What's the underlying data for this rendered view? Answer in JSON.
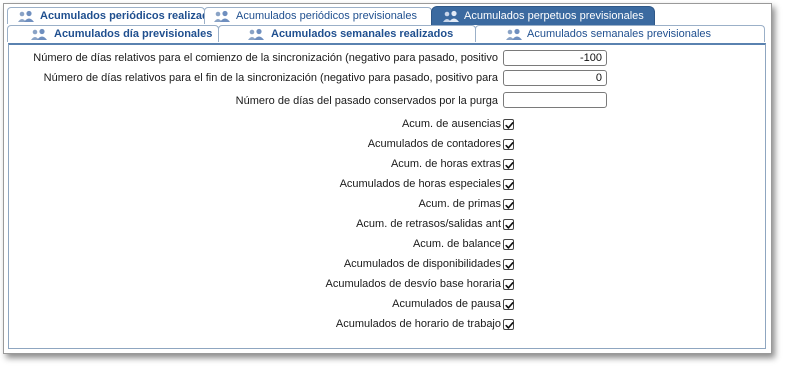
{
  "tabs": {
    "row1": [
      {
        "label": "Acumulados periódicos realizados"
      },
      {
        "label": "Acumulados periódicos previsionales"
      },
      {
        "label": "Acumulados perpetuos previsionales"
      }
    ],
    "row2": [
      {
        "label": "Acumulados día previsionales"
      },
      {
        "label": "Acumulados semanales realizados"
      },
      {
        "label": "Acumulados semanales previsionales"
      }
    ]
  },
  "fields": {
    "sync_start": {
      "label": "Número de días relativos para el comienzo de la sincronización (negativo para pasado, positivo",
      "value": "-100"
    },
    "sync_end": {
      "label": "Número de días relativos para el fin de la sincronización (negativo para pasado, positivo para",
      "value": "0"
    },
    "purge_days": {
      "label": "Número de días del pasado conservados por la purga",
      "value": ""
    }
  },
  "checkboxes": [
    {
      "label": "Acum. de ausencias",
      "checked": true
    },
    {
      "label": "Acumulados de contadores",
      "checked": true
    },
    {
      "label": "Acum. de horas extras",
      "checked": true
    },
    {
      "label": "Acumulados de horas especiales",
      "checked": true
    },
    {
      "label": "Acum. de primas",
      "checked": true
    },
    {
      "label": "Acum. de retrasos/salidas ant",
      "checked": true
    },
    {
      "label": "Acum. de balance",
      "checked": true
    },
    {
      "label": "Acumulados de disponibilidades",
      "checked": true
    },
    {
      "label": "Acumulados de desvío base horaria",
      "checked": true
    },
    {
      "label": "Acumulados de pausa",
      "checked": true
    },
    {
      "label": "Acumulados de horario de trabajo",
      "checked": true
    }
  ],
  "icons": {
    "tab": "users-group-icon",
    "check": "checkmark-icon"
  },
  "colors": {
    "accent": "#3b6aa0",
    "tab_text": "#1f4f8f"
  }
}
